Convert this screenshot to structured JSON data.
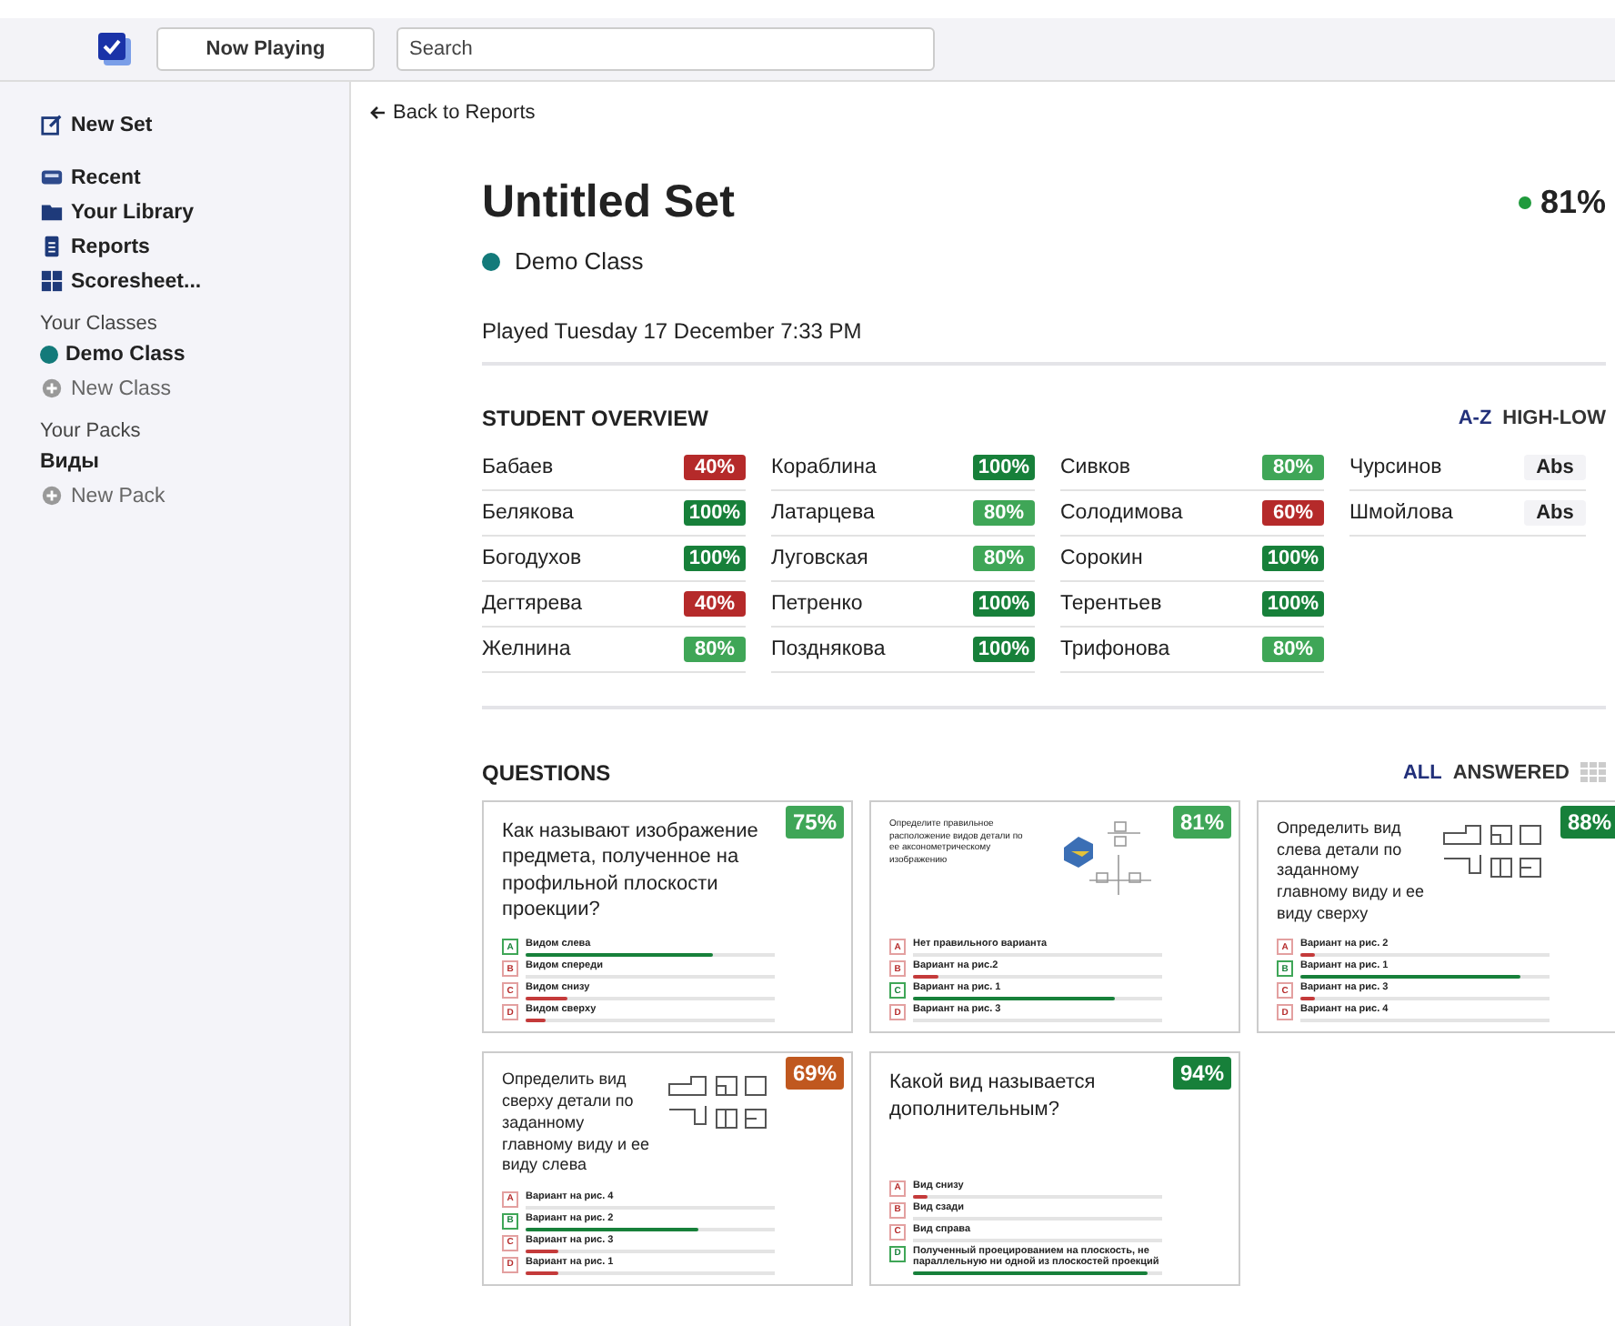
{
  "topbar": {
    "now_playing": "Now Playing",
    "search": {
      "placeholder": "Search"
    }
  },
  "sidebar": {
    "new_set": "New Set",
    "nav": [
      {
        "label": "Recent"
      },
      {
        "label": "Your Library"
      },
      {
        "label": "Reports"
      },
      {
        "label": "Scoresheet..."
      }
    ],
    "classes_heading": "Your Classes",
    "classes": [
      {
        "label": "Demo Class",
        "kind": "class",
        "color": "#137a7a"
      },
      {
        "label": "New Class",
        "kind": "add"
      }
    ],
    "packs_heading": "Your Packs",
    "packs": [
      {
        "label": "Виды",
        "kind": "pack"
      },
      {
        "label": "New Pack",
        "kind": "add"
      }
    ]
  },
  "back_link": "Back to Reports",
  "set": {
    "title": "Untitled Set",
    "score": "81%",
    "class_name": "Demo Class",
    "played": "Played Tuesday 17 December 7:33 PM"
  },
  "overview": {
    "heading": "STUDENT OVERVIEW",
    "sorts": [
      {
        "label": "A-Z",
        "selected": true
      },
      {
        "label": "HIGH-LOW",
        "selected": false
      }
    ],
    "columns": [
      [
        {
          "name": "Бабаев",
          "score": "40%",
          "color": "#b52a2a"
        },
        {
          "name": "Белякова",
          "score": "100%",
          "color": "#17803a"
        },
        {
          "name": "Богодухов",
          "score": "100%",
          "color": "#17803a"
        },
        {
          "name": "Дегтярева",
          "score": "40%",
          "color": "#b52a2a"
        },
        {
          "name": "Желнина",
          "score": "80%",
          "color": "#3fa657"
        }
      ],
      [
        {
          "name": "Кораблина",
          "score": "100%",
          "color": "#17803a"
        },
        {
          "name": "Латарцева",
          "score": "80%",
          "color": "#3fa657"
        },
        {
          "name": "Луговская",
          "score": "80%",
          "color": "#3fa657"
        },
        {
          "name": "Петренко",
          "score": "100%",
          "color": "#17803a"
        },
        {
          "name": "Позднякова",
          "score": "100%",
          "color": "#17803a"
        }
      ],
      [
        {
          "name": "Сивков",
          "score": "80%",
          "color": "#3fa657"
        },
        {
          "name": "Солодимова",
          "score": "60%",
          "color": "#b52a2a"
        },
        {
          "name": "Сорокин",
          "score": "100%",
          "color": "#17803a"
        },
        {
          "name": "Терентьев",
          "score": "100%",
          "color": "#17803a"
        },
        {
          "name": "Трифонова",
          "score": "80%",
          "color": "#3fa657"
        }
      ],
      [
        {
          "name": "Чурсинов",
          "score": "Abs",
          "color": "#f3f3f6"
        },
        {
          "name": "Шмойлова",
          "score": "Abs",
          "color": "#f3f3f6"
        }
      ]
    ]
  },
  "questions": {
    "heading": "QUESTIONS",
    "filters": [
      {
        "label": "ALL",
        "selected": true
      },
      {
        "label": "ANSWERED",
        "selected": false
      }
    ],
    "cards": [
      {
        "text": "Как называют изображение предмета, полученное на профильной плоскости проекции?",
        "kind": "text",
        "score": "75%",
        "color": "#3fa657",
        "answers": [
          {
            "letter": "A",
            "text": "Видом слева",
            "correct": true,
            "level": 0.75
          },
          {
            "letter": "B",
            "text": "Видом спереди",
            "correct": false
          },
          {
            "letter": "C",
            "text": "Видом снизу",
            "correct": false,
            "level": 0.17
          },
          {
            "letter": "D",
            "text": "Видом сверху",
            "correct": false,
            "level": 0.08
          }
        ]
      },
      {
        "text": "Определите правильное расположение видов детали по ее аксонометрическому изображению",
        "kind": "axonometric",
        "score": "81%",
        "color": "#3fa657",
        "answers": [
          {
            "letter": "A",
            "text": "Нет правильного варианта",
            "correct": false
          },
          {
            "letter": "B",
            "text": "Вариант на рис.2",
            "correct": false,
            "level": 0.1
          },
          {
            "letter": "C",
            "text": "Вариант на рис. 1",
            "correct": true,
            "level": 0.81
          },
          {
            "letter": "D",
            "text": "Вариант на рис. 3",
            "correct": false
          }
        ]
      },
      {
        "text": "Определить вид слева детали по заданному главному виду и ее виду сверху",
        "kind": "views",
        "score": "88%",
        "color": "#17803a",
        "answers": [
          {
            "letter": "A",
            "text": "Вариант на рис. 2",
            "correct": false,
            "level": 0.06
          },
          {
            "letter": "B",
            "text": "Вариант на рис. 1",
            "correct": true,
            "level": 0.88
          },
          {
            "letter": "C",
            "text": "Вариант на рис. 3",
            "correct": false,
            "level": 0.06
          },
          {
            "letter": "D",
            "text": "Вариант на рис. 4",
            "correct": false
          }
        ]
      },
      {
        "text": "Определить вид сверху детали по заданному главному виду и ее виду слева",
        "kind": "views",
        "score": "69%",
        "color": "#c0581f",
        "answers": [
          {
            "letter": "A",
            "text": "Вариант на рис. 4",
            "correct": false
          },
          {
            "letter": "B",
            "text": "Вариант на рис. 2",
            "correct": true,
            "level": 0.69
          },
          {
            "letter": "C",
            "text": "Вариант на рис. 3",
            "correct": false,
            "level": 0.13
          },
          {
            "letter": "D",
            "text": "Вариант на рис. 1",
            "correct": false,
            "level": 0.13
          }
        ]
      },
      {
        "text": "Какой вид называется дополнительным?",
        "kind": "text",
        "score": "94%",
        "color": "#17803a",
        "answers": [
          {
            "letter": "A",
            "text": "Вид снизу",
            "correct": false,
            "level": 0.06
          },
          {
            "letter": "B",
            "text": "Вид сзади",
            "correct": false
          },
          {
            "letter": "C",
            "text": "Вид справа",
            "correct": false
          },
          {
            "letter": "D",
            "text": "Полученный проецированием на плоскость, не параллельную ни одной из плоскостей проекций",
            "correct": true,
            "level": 0.94
          }
        ]
      }
    ]
  }
}
